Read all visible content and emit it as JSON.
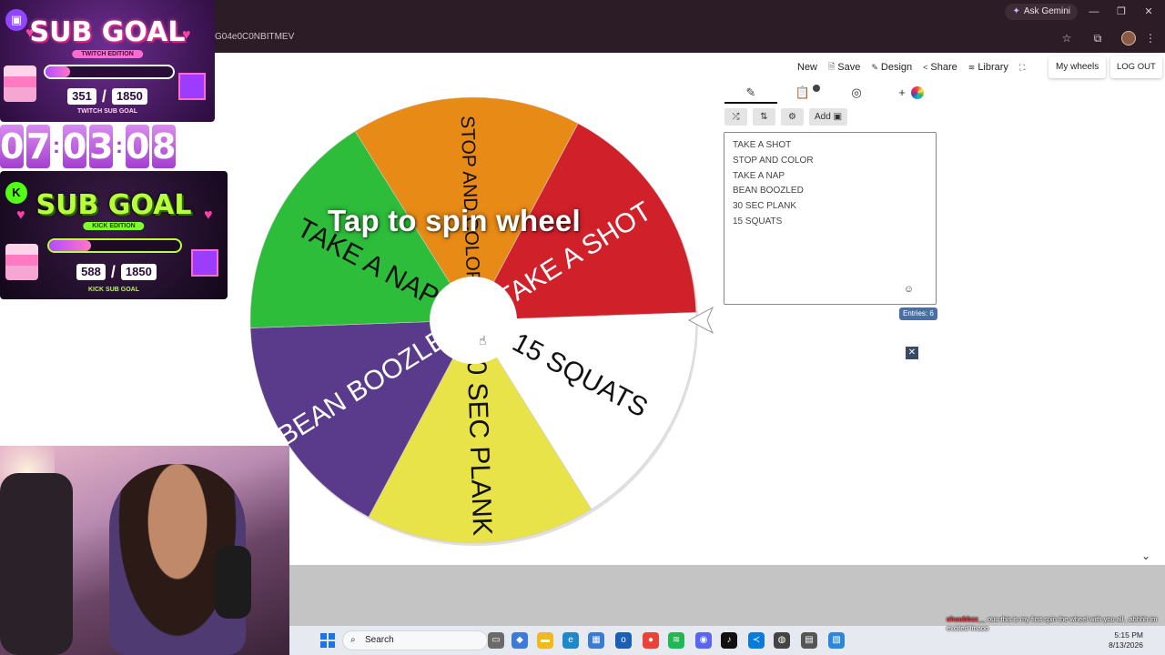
{
  "browser": {
    "ask_gemini": "Ask Gemini",
    "url_fragment": "G04e0C0NBITMEV"
  },
  "topnav": {
    "items": [
      {
        "label": "New",
        "icon": "none"
      },
      {
        "label": "Save",
        "icon": "save-icon"
      },
      {
        "label": "Design",
        "icon": "brush-icon"
      },
      {
        "label": "Share",
        "icon": "share-icon"
      },
      {
        "label": "Library",
        "icon": "layers-icon"
      }
    ],
    "my_wheels": "My wheels",
    "logout": "LOG OUT"
  },
  "tools": {
    "add_image_label": "Add"
  },
  "entries": {
    "items": [
      "TAKE A SHOT",
      "STOP AND COLOR",
      "TAKE A NAP",
      "BEAN BOOZLED",
      "30 SEC PLANK",
      "15 SQUATS"
    ],
    "count_label": "Entries: 6"
  },
  "wheel": {
    "prompt": "Tap to spin wheel",
    "segments": [
      {
        "label": "TAKE A SHOT",
        "color": "#d0202a"
      },
      {
        "label": "15 SQUATS",
        "color": "#ffffff"
      },
      {
        "label": "30 SEC PLANK",
        "color": "#e9e34a"
      },
      {
        "label": "BEAN BOOZLED",
        "color": "#5a3a8a"
      },
      {
        "label": "TAKE A NAP",
        "color": "#2ebd3a"
      },
      {
        "label": "STOP AND COLOR",
        "color": "#e88a16"
      }
    ]
  },
  "stream": {
    "twitch_goal": {
      "title": "SUB GOAL",
      "edition": "TWITCH EDITION",
      "current": "351",
      "target": "1850",
      "progress": 0.19,
      "footer": "TWITCH SUB GOAL"
    },
    "countdown": {
      "h": [
        "0",
        "7"
      ],
      "m": [
        "0",
        "3"
      ],
      "s": [
        "0",
        "8"
      ]
    },
    "kick_goal": {
      "title": "SUB GOAL",
      "edition": "KICK EDITION",
      "current": "588",
      "target": "1850",
      "progress": 0.32,
      "footer": "KICK SUB GOAL"
    }
  },
  "taskbar": {
    "search_label": "Search",
    "time": "5:15 PM",
    "date": "8/13/2026"
  },
  "chat": {
    "username": "chuubbzz__",
    "message": "ouu this is my first spin the wheel with you all , ahhhh im excited lmaoo"
  }
}
